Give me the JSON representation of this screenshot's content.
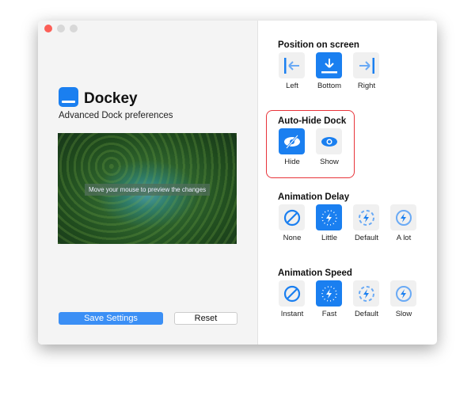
{
  "app": {
    "title": "Dockey",
    "subtitle": "Advanced Dock preferences",
    "preview_text": "Move your mouse to preview the changes",
    "save_label": "Save Settings",
    "reset_label": "Reset"
  },
  "colors": {
    "accent": "#1a7ff0",
    "highlight": "#e8343a"
  },
  "position": {
    "heading": "Position on screen",
    "options": [
      {
        "label": "Left",
        "icon": "arrow-left-bar-icon"
      },
      {
        "label": "Bottom",
        "icon": "arrow-down-bar-icon",
        "selected": true
      },
      {
        "label": "Right",
        "icon": "arrow-right-bar-icon"
      }
    ]
  },
  "autohide": {
    "heading": "Auto-Hide Dock",
    "options": [
      {
        "label": "Hide",
        "icon": "eye-slash-icon",
        "selected": true
      },
      {
        "label": "Show",
        "icon": "eye-icon"
      }
    ]
  },
  "delay": {
    "heading": "Animation Delay",
    "options": [
      {
        "label": "None"
      },
      {
        "label": "Little",
        "selected": true
      },
      {
        "label": "Default"
      },
      {
        "label": "A lot"
      }
    ]
  },
  "speed": {
    "heading": "Animation Speed",
    "options": [
      {
        "label": "Instant"
      },
      {
        "label": "Fast",
        "selected": true
      },
      {
        "label": "Default"
      },
      {
        "label": "Slow"
      }
    ]
  }
}
